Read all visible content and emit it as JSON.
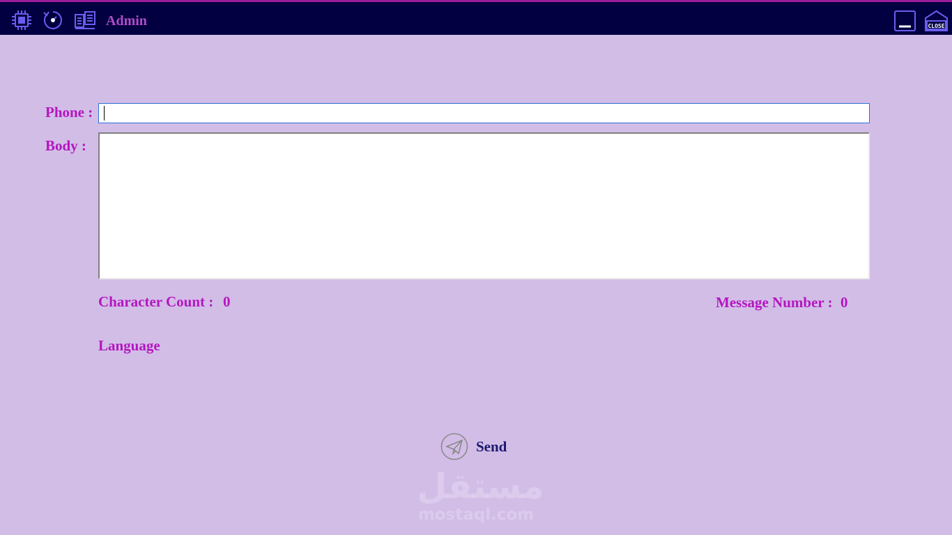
{
  "window": {
    "title": "Admin",
    "icons": [
      "chip-icon",
      "refresh-clock-icon",
      "book-icon",
      "minimize-icon",
      "close-icon"
    ],
    "close_label": "CLOSE",
    "colors": {
      "titlebar_bg": "#020040",
      "accent_top": "#9b1f9b",
      "icon": "#6a5cf0"
    }
  },
  "form": {
    "phone_label": "Phone :",
    "phone_value": "",
    "body_label": "Body :",
    "body_value": "",
    "char_count_label": "Character Count :",
    "char_count_value": "0",
    "message_number_label": "Message Number :",
    "message_number_value": "0",
    "language_label": "Language",
    "send_label": "Send",
    "colors": {
      "label": "#b416c0",
      "send": "#1a1a6e",
      "background": "#d2bde7"
    }
  },
  "watermark": {
    "arabic": "مستقل",
    "latin": "mostaql.com"
  }
}
